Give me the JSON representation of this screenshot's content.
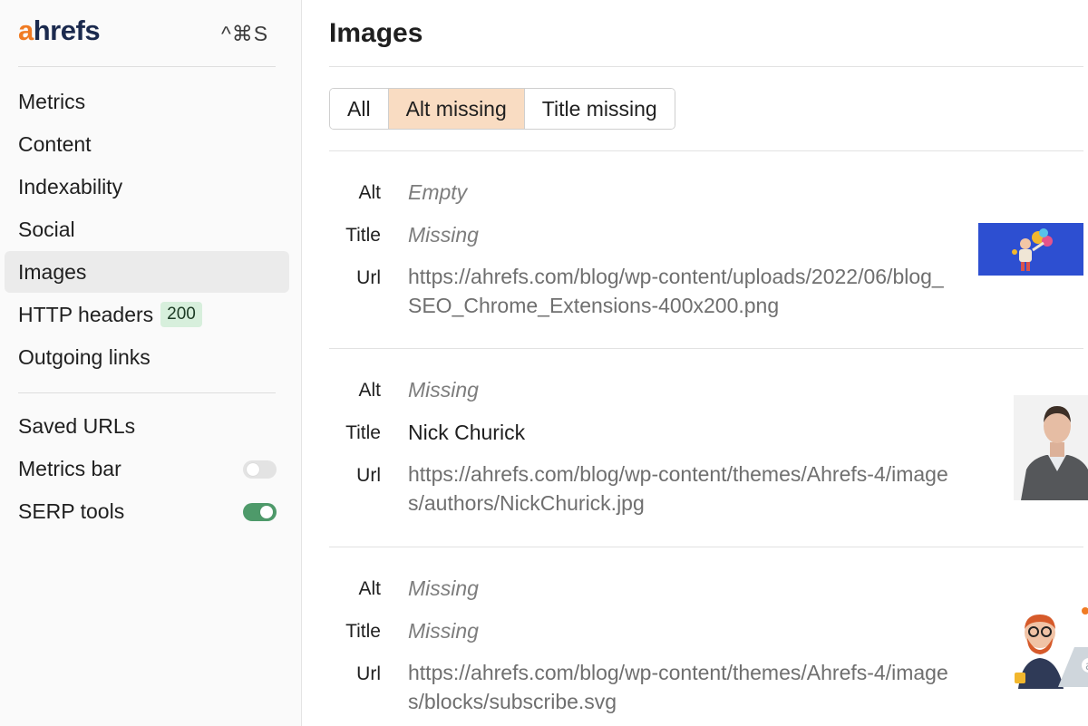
{
  "sidebar": {
    "brand_a": "a",
    "brand_rest": "hrefs",
    "shortcut": "^⌘S",
    "items": [
      {
        "label": "Metrics"
      },
      {
        "label": "Content"
      },
      {
        "label": "Indexability"
      },
      {
        "label": "Social"
      },
      {
        "label": "Images"
      },
      {
        "label": "HTTP headers",
        "badge": "200"
      },
      {
        "label": "Outgoing links"
      }
    ],
    "settings": [
      {
        "label": "Saved URLs"
      },
      {
        "label": "Metrics bar",
        "toggle": "off"
      },
      {
        "label": "SERP tools",
        "toggle": "on"
      }
    ]
  },
  "main": {
    "title": "Images",
    "tabs": [
      {
        "label": "All"
      },
      {
        "label": "Alt missing"
      },
      {
        "label": "Title missing"
      }
    ],
    "field_labels": {
      "alt": "Alt",
      "title": "Title",
      "url": "Url"
    },
    "images": [
      {
        "alt": "Empty",
        "title": "Missing",
        "url": "https://ahrefs.com/blog/wp-content/uploads/2022/06/blog_SEO_Chrome_Extensions-400x200.png"
      },
      {
        "alt": "Missing",
        "title": "Nick Churick",
        "url": "https://ahrefs.com/blog/wp-content/themes/Ahrefs-4/images/authors/NickChurick.jpg"
      },
      {
        "alt": "Missing",
        "title": "Missing",
        "url": "https://ahrefs.com/blog/wp-content/themes/Ahrefs-4/images/blocks/subscribe.svg"
      }
    ]
  },
  "colors": {
    "brand_orange": "#f07b23",
    "brand_navy": "#1b2a4e",
    "active_tab": "#f9dcc2",
    "badge_bg": "#d7efdc",
    "toggle_on": "#4e9a6a"
  }
}
